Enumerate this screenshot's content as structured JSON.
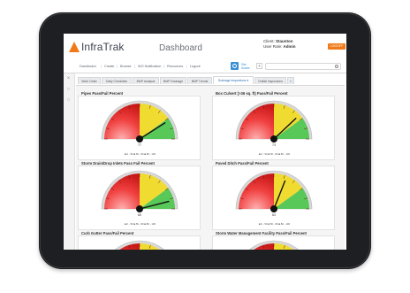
{
  "app": {
    "logo_text": "InfraTrak",
    "page_title": "Dashboard",
    "client_label": "Client:",
    "client_value": "Staunton",
    "role_label": "User Role:",
    "role_value": "Admin",
    "logout_label": "LOGOFF"
  },
  "nav": {
    "items": [
      "Dashboard",
      "Create",
      "Browse",
      "WO Notification",
      "Resources",
      "Logout"
    ],
    "site_line1": "Site",
    "site_line2": "Assets",
    "plus_label": "+"
  },
  "tabs": [
    {
      "label": "Work Order"
    },
    {
      "label": "Daily Checklists"
    },
    {
      "label": "BMP Analysis"
    },
    {
      "label": "BMP Drainage"
    },
    {
      "label": "BMP Trends"
    },
    {
      "label": "Drainage Inspections ▾"
    },
    {
      "label": "Outfall Inspections"
    },
    {
      "label": "»"
    }
  ],
  "sidebar_icons": [
    "close-icon",
    "settings-icon",
    "refresh-icon"
  ],
  "gauges": [
    {
      "title": "Pipes Pass/Fail Percent",
      "needle": 0.82,
      "value_label": "77",
      "legend": "■ 0 - 50 ■ 50 - 80 ■ 80 - 100"
    },
    {
      "title": "Box Culvert (>36 sq. ft) Pass/Fail Percent",
      "needle": 0.76,
      "value_label": "73",
      "legend": "■ 0 - 50 ■ 50 - 80 ■ 80 - 100"
    },
    {
      "title": "Storm Drain/Drop Inlets Pass Fail Percent",
      "needle": 0.92,
      "value_label": "80",
      "legend": "■ 0 - 50 ■ 50 - 80 ■ 80 - 100"
    },
    {
      "title": "Paved Ditch Pass/Fail Percent",
      "needle": 0.62,
      "value_label": "63",
      "legend": "■ 0 - 50 ■ 50 - 80 ■ 80 - 100"
    },
    {
      "title": "Curb Gutter Pass/Fail Percent",
      "needle": 0.7,
      "value_label": "",
      "legend": ""
    },
    {
      "title": "Storm Water Management Facility Pass/Fail Percent",
      "needle": 0.7,
      "value_label": "",
      "legend": ""
    }
  ],
  "colors": {
    "accent": "#f07a1a",
    "link": "#2c6fb3",
    "red": "#e02020",
    "yellow": "#e8d000",
    "green": "#3fb83f"
  }
}
